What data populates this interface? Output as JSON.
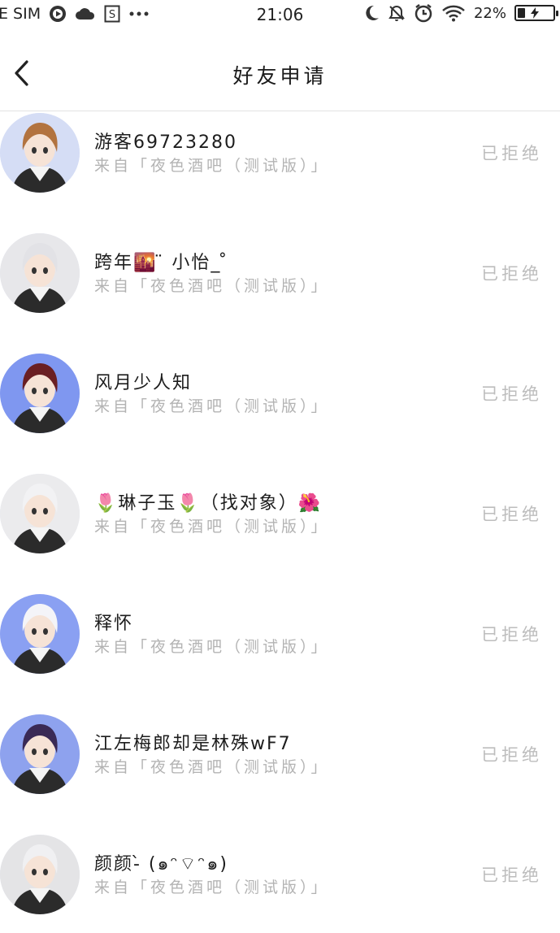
{
  "status_bar": {
    "carrier": "E SIM",
    "time": "21:06",
    "battery": "22%",
    "battery_level": 0.22,
    "icons": [
      "play-icon",
      "cloud-icon",
      "sim-card-icon",
      "more-dots-icon",
      "moon-icon",
      "bell-off-icon",
      "alarm-icon",
      "wifi-icon",
      "battery-icon"
    ]
  },
  "header": {
    "title": "好友申请",
    "back_icon": "chevron-left-icon"
  },
  "requests": [
    {
      "name": "游客69723280",
      "from": "来自「夜色酒吧（测试版）」",
      "status": "已拒绝",
      "avatar_bg": "#d5ddf5",
      "hair": "#b2733f"
    },
    {
      "name": "跨年🌇 ̈ 小怡_ ̊",
      "from": "来自「夜色酒吧（测试版）」",
      "status": "已拒绝",
      "avatar_bg": "#e7e7ea",
      "hair": "#e2e2e6"
    },
    {
      "name": "风月少人知",
      "from": "来自「夜色酒吧（测试版）」",
      "status": "已拒绝",
      "avatar_bg": "#7f97f0",
      "hair": "#6a1f23"
    },
    {
      "name": "🌷琳子玉🌷（找对象）🌺",
      "from": "来自「夜色酒吧（测试版）」",
      "status": "已拒绝",
      "avatar_bg": "#ebebed",
      "hair": "#f2f2f4"
    },
    {
      "name": "释怀",
      "from": "来自「夜色酒吧（测试版）」",
      "status": "已拒绝",
      "avatar_bg": "#8aa0f2",
      "hair": "#f4f4f8"
    },
    {
      "name": "江左梅郎却是林殊wF7",
      "from": "来自「夜色酒吧（测试版）」",
      "status": "已拒绝",
      "avatar_bg": "#8ea2ee",
      "hair": "#3a2a55"
    },
    {
      "name": "颜颜-̀ (๑ᵔ⌔ᵔ๑)",
      "from": "来自「夜色酒吧（测试版）」",
      "status": "已拒绝",
      "avatar_bg": "#e4e4e6",
      "hair": "#f0f0f2"
    }
  ]
}
